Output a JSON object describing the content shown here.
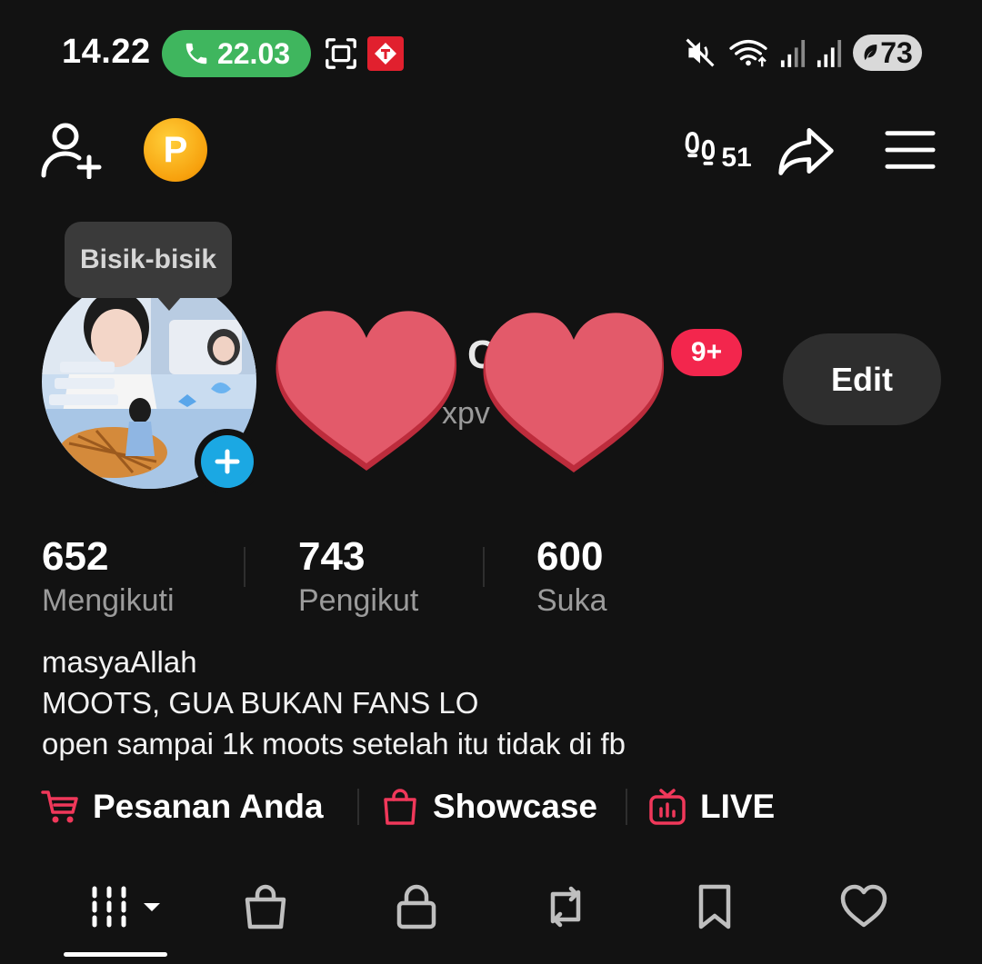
{
  "status_bar": {
    "time": "14.22",
    "call_duration": "22.03",
    "battery": "73"
  },
  "header": {
    "coin_label": "P",
    "footprint_count": "51"
  },
  "profile": {
    "tooltip": "Bisik-bisik",
    "name_fragment": "C",
    "handle_fragment": "xpv",
    "notification_badge": "9+",
    "edit_label": "Edit"
  },
  "stats": [
    {
      "value": "652",
      "label": "Mengikuti"
    },
    {
      "value": "743",
      "label": "Pengikut"
    },
    {
      "value": "600",
      "label": "Suka"
    }
  ],
  "bio": [
    "masyaAllah",
    "MOOTS, GUA BUKAN FANS LO",
    "open sampai 1k moots setelah itu tidak di fb"
  ],
  "links": [
    {
      "label": "Pesanan Anda",
      "icon": "cart-icon"
    },
    {
      "label": "Showcase",
      "icon": "bag-icon"
    },
    {
      "label": "LIVE",
      "icon": "tv-icon"
    }
  ],
  "tabs": [
    "grid-icon",
    "shop-icon",
    "lock-icon",
    "repost-icon",
    "bookmark-icon",
    "heart-icon"
  ],
  "colors": {
    "background": "#121212",
    "call_green": "#3fb65e",
    "badge_red": "#f3264d",
    "accent_blue": "#1ba8e3",
    "link_icon_red": "#f0385a",
    "heart_pink": "#e55a6b",
    "coin_gold": "#f7a10d"
  }
}
